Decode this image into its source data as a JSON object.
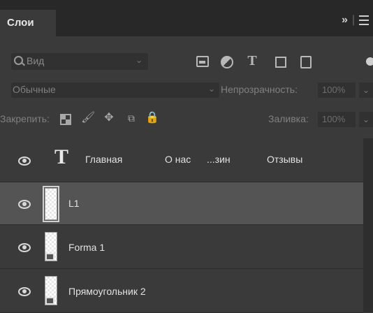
{
  "panel": {
    "tab_label": "Слои",
    "collapse_label": "»",
    "filter": {
      "label": "Вид"
    },
    "blend_mode": "Обычные",
    "opacity_label": "Непрозрачность:",
    "opacity_value": "100%",
    "lock_label": "Закрепить:",
    "fill_label": "Заливка:",
    "fill_value": "100%"
  },
  "layers": [
    {
      "type": "text",
      "words": [
        "Главная",
        "О нас",
        "...зин",
        "Отзывы"
      ],
      "visible": true,
      "selected": false
    },
    {
      "type": "smart",
      "name": "L1",
      "visible": true,
      "selected": true
    },
    {
      "type": "shape",
      "name": "Forma 1",
      "visible": true,
      "selected": false
    },
    {
      "type": "shape",
      "name": "Прямоугольник 2",
      "visible": true,
      "selected": false
    }
  ],
  "colors": {
    "panel_bg": "#3a3a3a",
    "tabbar_bg": "#282828",
    "selected_row": "#545454"
  }
}
